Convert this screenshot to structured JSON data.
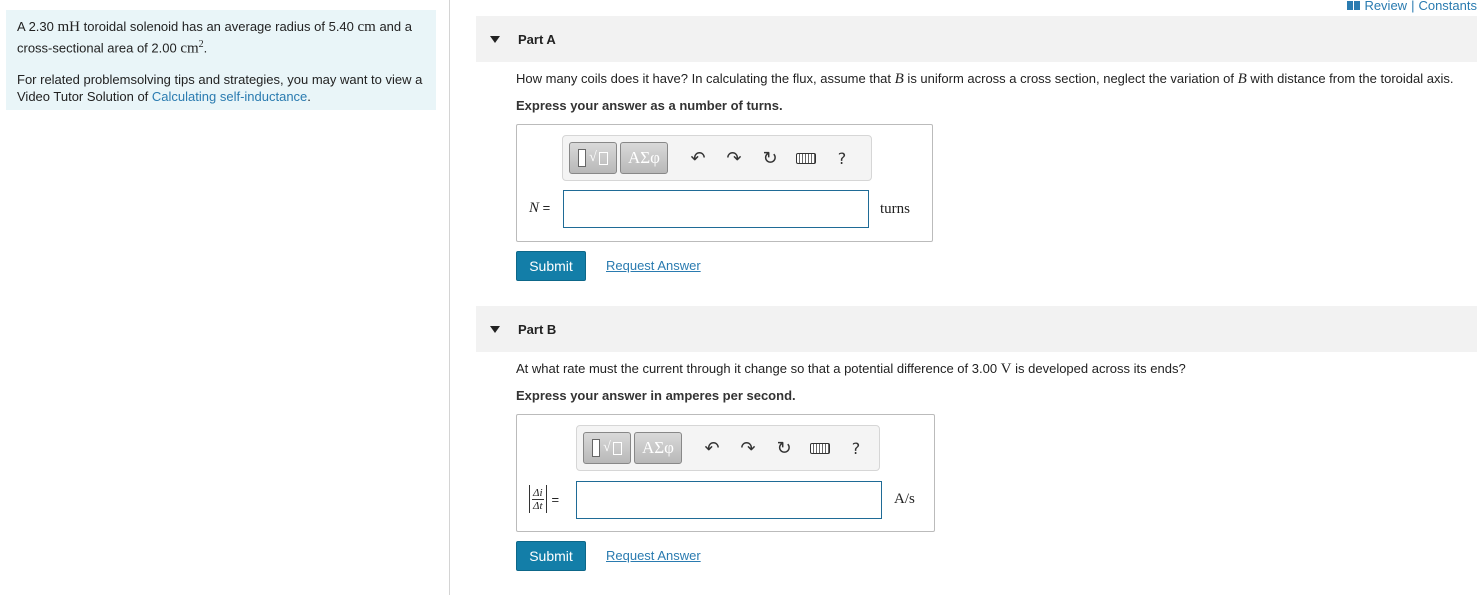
{
  "topbar": {
    "review": "Review",
    "separator": "|",
    "constants": "Constants"
  },
  "problem": {
    "text1_a": "A 2.30 ",
    "text1_unit": "mH",
    "text1_b": " toroidal solenoid has an average radius of 5.40 ",
    "text1_unit2": "cm",
    "text1_c": " and a cross-sectional area of 2.00 ",
    "text1_unit3": "cm",
    "text1_sup": "2",
    "text1_d": ".",
    "text2_a": "For related problemsolving tips and strategies, you may want to view a Video Tutor Solution of ",
    "text2_link": "Calculating self-inductance",
    "text2_b": "."
  },
  "partA": {
    "title": "Part A",
    "question_a": "How many coils does it have? In calculating the flux, assume that ",
    "question_var1": "B",
    "question_b": " is uniform across a cross section, neglect the variation of ",
    "question_var2": "B",
    "question_c": " with distance from the toroidal axis.",
    "instruction": "Express your answer as a number of turns.",
    "var_label": "N",
    "equals": " =",
    "input_value": "",
    "unit": "turns",
    "submit": "Submit",
    "request": "Request Answer"
  },
  "partB": {
    "title": "Part B",
    "question_a": "At what rate must the current through it change so that a potential difference of 3.00 ",
    "question_unit": "V",
    "question_b": " is developed across its ends?",
    "instruction": "Express your answer in amperes per second.",
    "frac_num": "Δi",
    "frac_den": "Δt",
    "equals": "=",
    "input_value": "",
    "unit": "A/s",
    "submit": "Submit",
    "request": "Request Answer"
  },
  "toolbar": {
    "greek": "ΑΣφ",
    "undo": "↶",
    "redo": "↷",
    "reset": "↻",
    "help": "?"
  }
}
